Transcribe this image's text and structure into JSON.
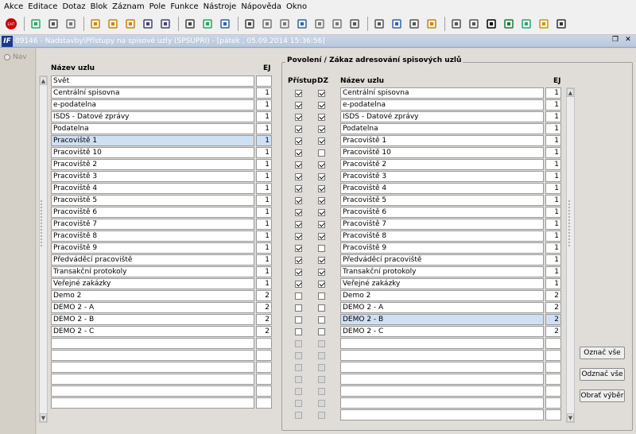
{
  "menu": [
    "Akce",
    "Editace",
    "Dotaz",
    "Blok",
    "Záznam",
    "Pole",
    "Funkce",
    "Nástroje",
    "Nápověda",
    "Okno"
  ],
  "toolbar": {
    "icons": [
      "exit-icon",
      "save-icon",
      "print-icon",
      "clear-icon",
      "enter-query-icon",
      "execute-query-icon",
      "cancel-query-icon",
      "sort-icon",
      "filter-icon",
      "calculator-icon",
      "save-record-icon",
      "email-icon",
      "cut-icon",
      "copy-icon",
      "paste-icon",
      "find-icon",
      "insert-row-icon",
      "delete-row-icon",
      "attachment-icon",
      "document-icon",
      "globe-icon",
      "settings-icon",
      "warning-icon",
      "report-icon",
      "notes-icon",
      "sum-icon",
      "excel-icon",
      "export-icon",
      "lock-icon",
      "help-icon"
    ]
  },
  "window": {
    "title": "09146 - Nadstavby\\Přístupy na spisové uzly (SPSUPRI) - [pátek , 05.09.2014 15:36:56]",
    "app_icon": "IF"
  },
  "nav": {
    "label": "Nav"
  },
  "left": {
    "col_name": "Název uzlu",
    "col_ej": "EJ",
    "rows": [
      {
        "name": "Svět",
        "ej": ""
      },
      {
        "name": "Centrální spisovna",
        "ej": "1"
      },
      {
        "name": "e-podatelna",
        "ej": "1"
      },
      {
        "name": "ISDS - Datové zprávy",
        "ej": "1"
      },
      {
        "name": "Podatelna",
        "ej": "1"
      },
      {
        "name": "Pracoviště 1",
        "ej": "1"
      },
      {
        "name": "Pracoviště 10",
        "ej": "1"
      },
      {
        "name": "Pracoviště 2",
        "ej": "1"
      },
      {
        "name": "Pracoviště 3",
        "ej": "1"
      },
      {
        "name": "Pracoviště 4",
        "ej": "1"
      },
      {
        "name": "Pracoviště 5",
        "ej": "1"
      },
      {
        "name": "Pracoviště 6",
        "ej": "1"
      },
      {
        "name": "Pracoviště 7",
        "ej": "1"
      },
      {
        "name": "Pracoviště 8",
        "ej": "1"
      },
      {
        "name": "Pracoviště 9",
        "ej": "1"
      },
      {
        "name": "Předváděcí pracoviště",
        "ej": "1"
      },
      {
        "name": "Transakční protokoly",
        "ej": "1"
      },
      {
        "name": "Veřejné zakázky",
        "ej": "1"
      },
      {
        "name": "Demo 2",
        "ej": "2"
      },
      {
        "name": "DEMO 2 - A",
        "ej": "2"
      },
      {
        "name": "DEMO 2 - B",
        "ej": "2"
      },
      {
        "name": "DEMO 2 - C",
        "ej": "2"
      },
      {
        "name": "",
        "ej": ""
      },
      {
        "name": "",
        "ej": ""
      },
      {
        "name": "",
        "ej": ""
      },
      {
        "name": "",
        "ej": ""
      },
      {
        "name": "",
        "ej": ""
      },
      {
        "name": "",
        "ej": ""
      }
    ],
    "selected_index": 5
  },
  "right": {
    "group_title": "Povolení / Zákaz adresování spisových uzlů",
    "col_access": "Přístup",
    "col_dz": "DZ",
    "col_name": "Název uzlu",
    "col_ej": "EJ",
    "rows": [
      {
        "name": "Centrální spisovna",
        "ej": "1",
        "access": true,
        "dz": true
      },
      {
        "name": "e-podatelna",
        "ej": "1",
        "access": true,
        "dz": true
      },
      {
        "name": "ISDS - Datové zprávy",
        "ej": "1",
        "access": true,
        "dz": true
      },
      {
        "name": "Podatelna",
        "ej": "1",
        "access": true,
        "dz": true
      },
      {
        "name": "Pracoviště 1",
        "ej": "1",
        "access": true,
        "dz": true
      },
      {
        "name": "Pracoviště 10",
        "ej": "1",
        "access": true,
        "dz": false
      },
      {
        "name": "Pracoviště 2",
        "ej": "1",
        "access": true,
        "dz": true
      },
      {
        "name": "Pracoviště 3",
        "ej": "1",
        "access": true,
        "dz": true
      },
      {
        "name": "Pracoviště 4",
        "ej": "1",
        "access": true,
        "dz": true
      },
      {
        "name": "Pracoviště 5",
        "ej": "1",
        "access": true,
        "dz": true
      },
      {
        "name": "Pracoviště 6",
        "ej": "1",
        "access": true,
        "dz": true
      },
      {
        "name": "Pracoviště 7",
        "ej": "1",
        "access": true,
        "dz": true
      },
      {
        "name": "Pracoviště 8",
        "ej": "1",
        "access": true,
        "dz": true
      },
      {
        "name": "Pracoviště 9",
        "ej": "1",
        "access": true,
        "dz": false
      },
      {
        "name": "Předváděcí pracoviště",
        "ej": "1",
        "access": true,
        "dz": true
      },
      {
        "name": "Transakční protokoly",
        "ej": "1",
        "access": true,
        "dz": true
      },
      {
        "name": "Veřejné zakázky",
        "ej": "1",
        "access": true,
        "dz": true
      },
      {
        "name": "Demo 2",
        "ej": "2",
        "access": false,
        "dz": false
      },
      {
        "name": "DEMO 2 - A",
        "ej": "2",
        "access": false,
        "dz": false
      },
      {
        "name": "DEMO 2 - B",
        "ej": "2",
        "access": false,
        "dz": false
      },
      {
        "name": "DEMO 2 - C",
        "ej": "2",
        "access": false,
        "dz": false
      },
      {
        "name": "",
        "ej": "",
        "access": false,
        "dz": false,
        "disabled": true
      },
      {
        "name": "",
        "ej": "",
        "access": false,
        "dz": false,
        "disabled": true
      },
      {
        "name": "",
        "ej": "",
        "access": false,
        "dz": false,
        "disabled": true
      },
      {
        "name": "",
        "ej": "",
        "access": false,
        "dz": false,
        "disabled": true
      },
      {
        "name": "",
        "ej": "",
        "access": false,
        "dz": false,
        "disabled": true
      },
      {
        "name": "",
        "ej": "",
        "access": false,
        "dz": false,
        "disabled": true
      },
      {
        "name": "",
        "ej": "",
        "access": false,
        "dz": false,
        "disabled": true
      }
    ],
    "selected_index": 19
  },
  "buttons": {
    "select_all": "Označ vše",
    "deselect_all": "Odznač vše",
    "invert": "Obrať výběr"
  },
  "colors": {
    "selected_row": "#cfe0f5",
    "title_bar": "#c9d6e6"
  }
}
